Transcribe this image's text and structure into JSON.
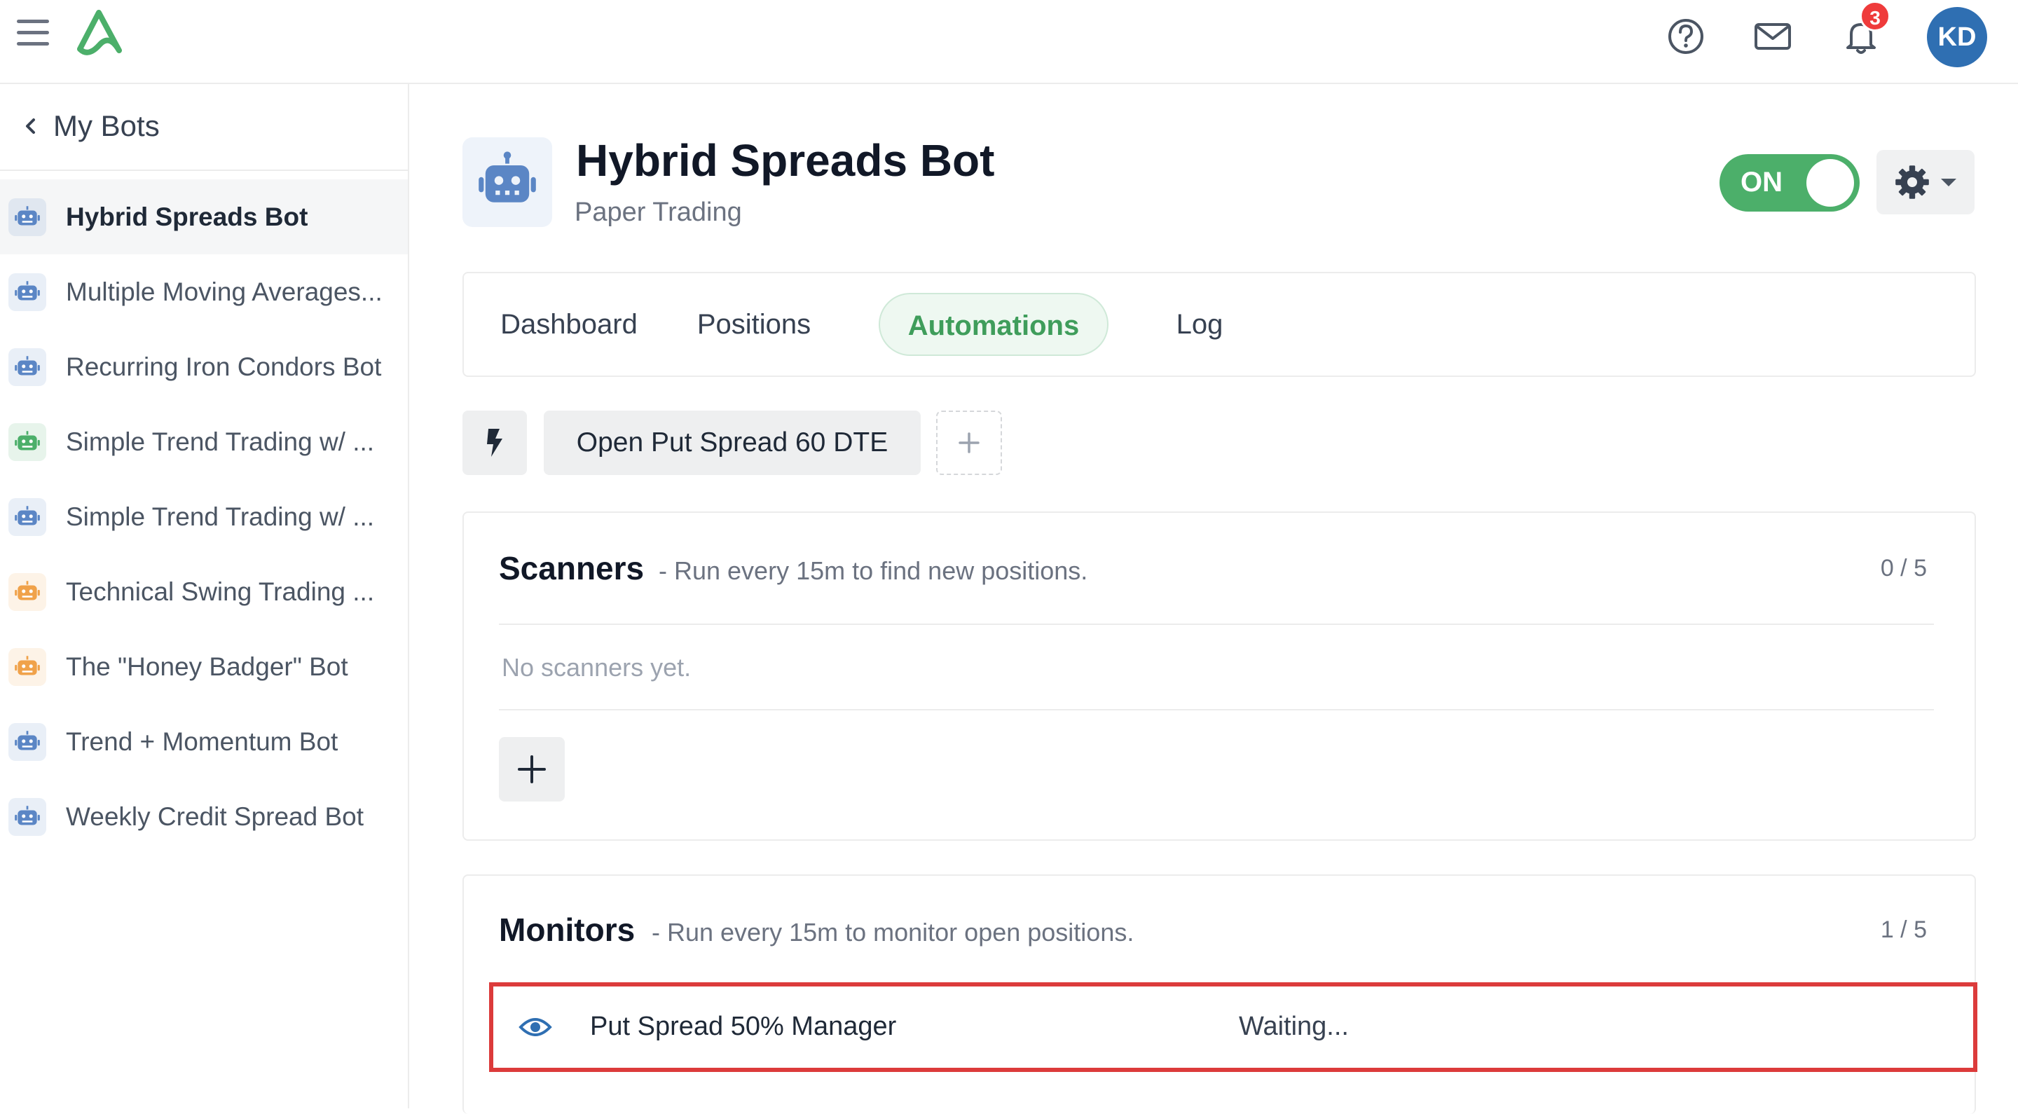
{
  "topbar": {
    "notification_count": "3",
    "avatar_initials": "KD",
    "icons": [
      "menu-icon",
      "app-logo",
      "help-icon",
      "mail-icon",
      "bell-icon"
    ]
  },
  "sidebar": {
    "back_label": "My Bots",
    "bots": [
      {
        "name": "Hybrid Spreads Bot",
        "color": "#5b86c5",
        "active": true
      },
      {
        "name": "Multiple Moving Averages...",
        "color": "#5b86c5"
      },
      {
        "name": "Recurring Iron Condors Bot",
        "color": "#5b86c5"
      },
      {
        "name": "Simple Trend Trading w/ ...",
        "color": "#4caf6a"
      },
      {
        "name": "Simple Trend Trading w/ ...",
        "color": "#5b86c5"
      },
      {
        "name": "Technical Swing Trading ...",
        "color": "#f0a24a"
      },
      {
        "name": "The \"Honey Badger\" Bot",
        "color": "#f0a24a"
      },
      {
        "name": "Trend + Momentum Bot",
        "color": "#5b86c5"
      },
      {
        "name": "Weekly Credit Spread Bot",
        "color": "#5b86c5"
      }
    ]
  },
  "header": {
    "title": "Hybrid Spreads Bot",
    "subtitle": "Paper Trading",
    "toggle_label": "ON",
    "toggle_on": true
  },
  "tabs": [
    {
      "label": "Dashboard"
    },
    {
      "label": "Positions"
    },
    {
      "label": "Automations",
      "active": true
    },
    {
      "label": "Log"
    }
  ],
  "automations": {
    "selected": "Open Put Spread 60 DTE"
  },
  "scanners": {
    "title": "Scanners",
    "description": "- Run every 15m to find new positions.",
    "count": "0 / 5",
    "empty_text": "No scanners yet."
  },
  "monitors": {
    "title": "Monitors",
    "description": "- Run every 15m to monitor open positions.",
    "count": "1 / 5",
    "items": [
      {
        "name": "Put Spread 50% Manager",
        "status": "Waiting..."
      }
    ]
  },
  "colors": {
    "accent_green": "#4caf6a",
    "bot_blue": "#5b86c5",
    "bot_orange": "#f0a24a",
    "highlight_red": "#dc3b3b",
    "avatar_blue": "#2f6fb2",
    "badge_red": "#ef3b3b"
  }
}
